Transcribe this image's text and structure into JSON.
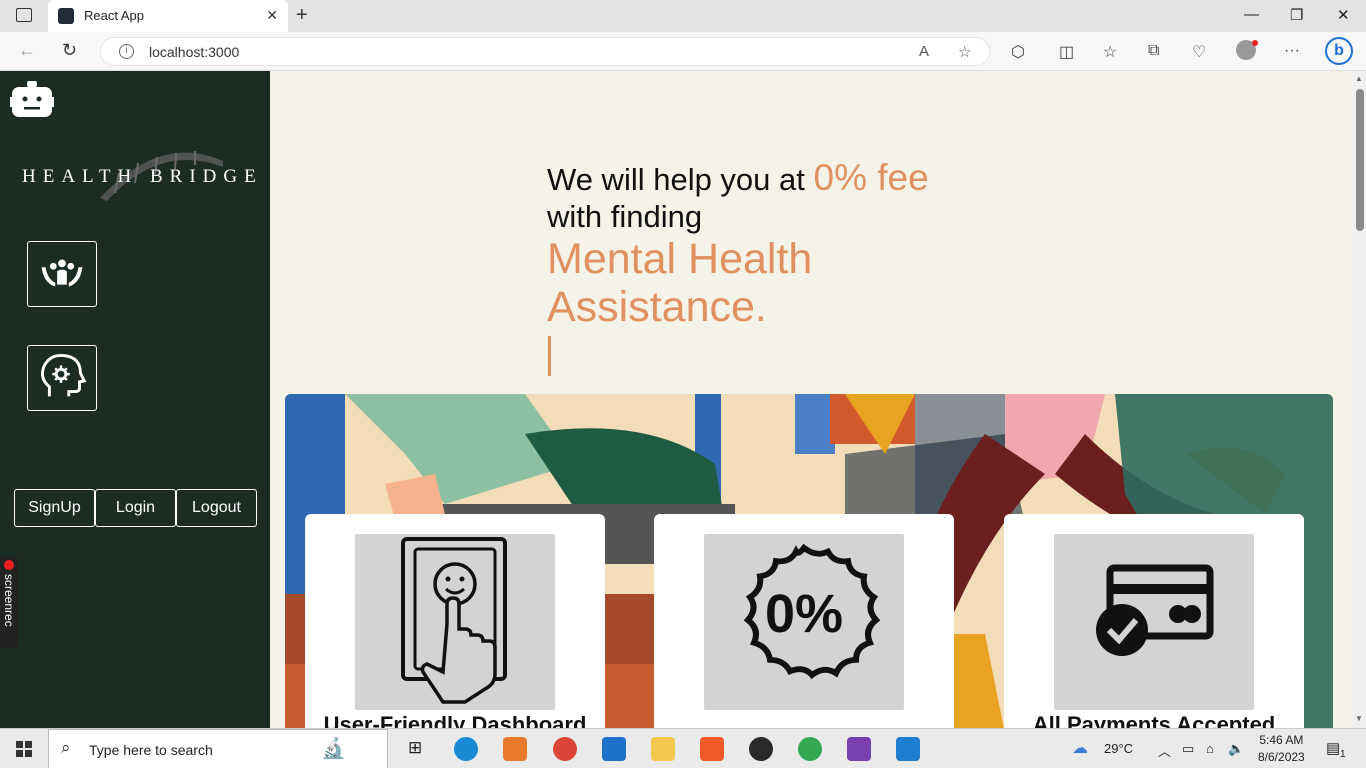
{
  "browser": {
    "tab_title": "React App",
    "url": "localhost:3000"
  },
  "sidebar": {
    "brand": "HEALTH BRIDGE",
    "auth": {
      "signup": "SignUp",
      "login": "Login",
      "logout": "Logout"
    }
  },
  "screenrec": "screenrec",
  "hero": {
    "line1": "We will help you at ",
    "accent": "0% fee",
    "line2": "with finding",
    "highlight": "Mental Health Assistance."
  },
  "cards": [
    {
      "caption": "User-Friendly Dashboard",
      "icon": "touch-screen-smiley-icon"
    },
    {
      "caption": "",
      "icon": "zero-percent-badge-icon",
      "badge_text": "0%"
    },
    {
      "caption": "All Payments Accepted",
      "icon": "card-payment-check-icon"
    }
  ],
  "taskbar": {
    "search_placeholder": "Type here to search",
    "weather": "29°C",
    "time": "5:46 AM",
    "date": "8/6/2023",
    "notifications": "1"
  },
  "colors": {
    "sidebar": "#1b2d23",
    "accent": "#e0915f",
    "background": "#f5f2e8"
  }
}
